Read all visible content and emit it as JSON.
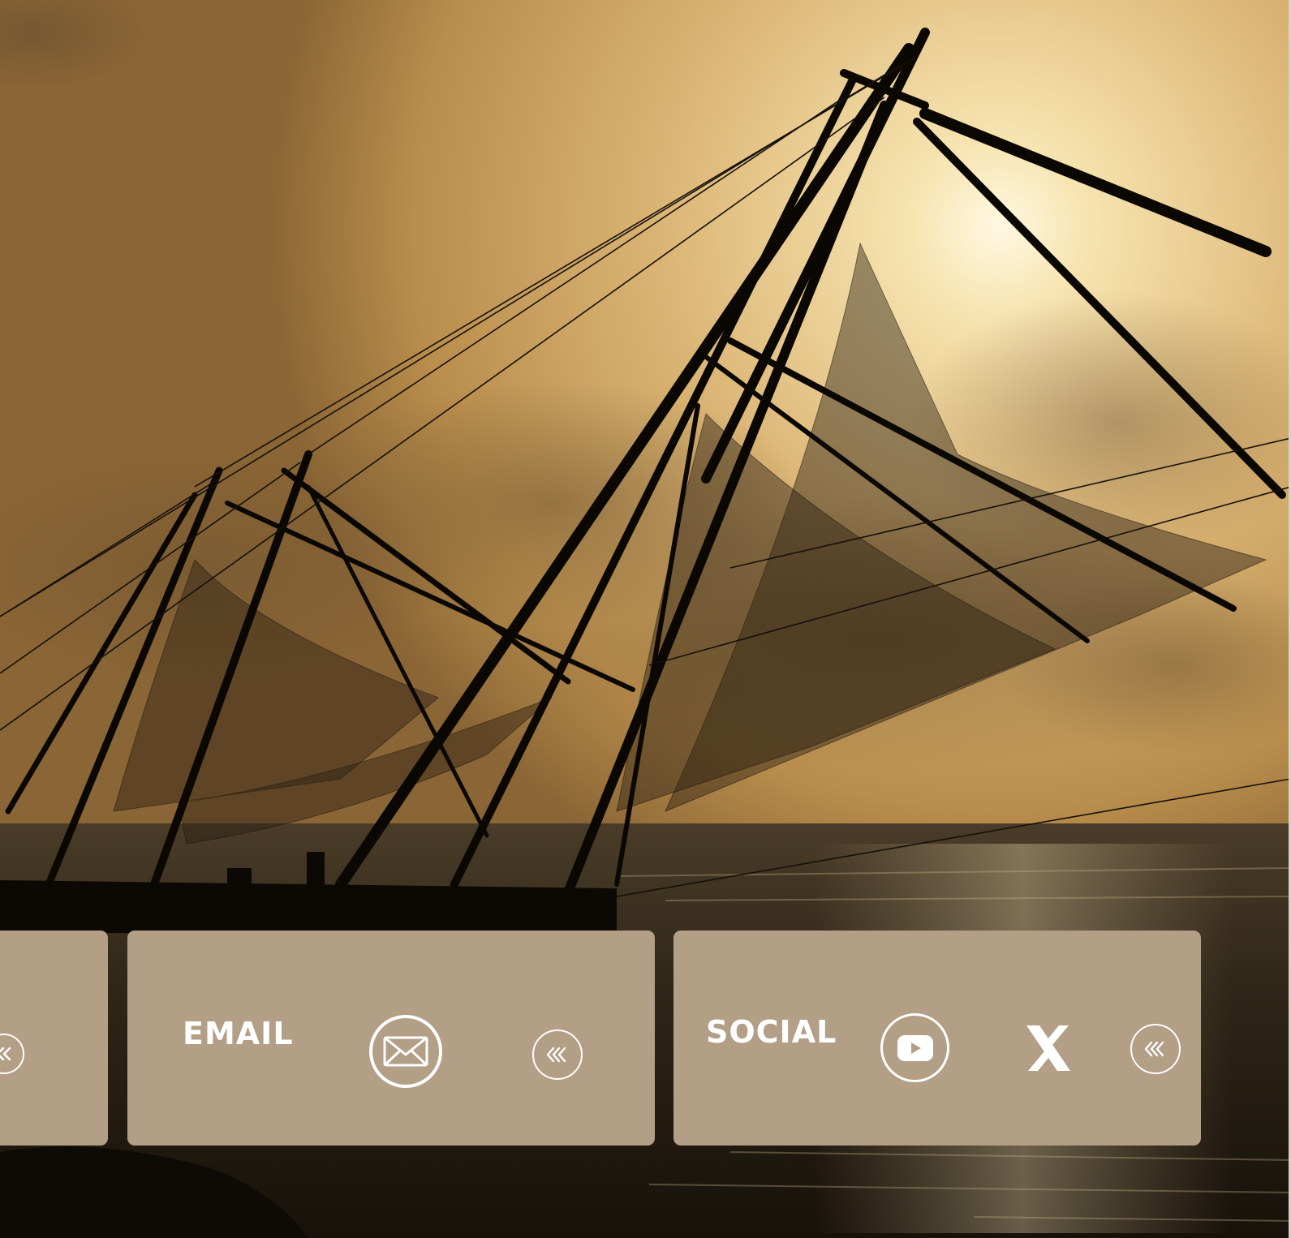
{
  "colors": {
    "card_background": "#b39e86",
    "card_foreground": "#ffffff",
    "sky_light": "#f5e0a8",
    "sky_mid": "#d9b472",
    "sea_dark": "#2a2216"
  },
  "cards": [
    {
      "id": "partial-card",
      "icons": [
        "double-chevron-left-icon"
      ]
    },
    {
      "id": "email-card",
      "label": "EMAIL",
      "icons": [
        "envelope-icon",
        "triple-chevron-left-icon"
      ]
    },
    {
      "id": "social-card",
      "label": "SOCIAL",
      "icons": [
        "youtube-icon",
        "x-logo-icon",
        "triple-chevron-left-icon"
      ]
    }
  ]
}
